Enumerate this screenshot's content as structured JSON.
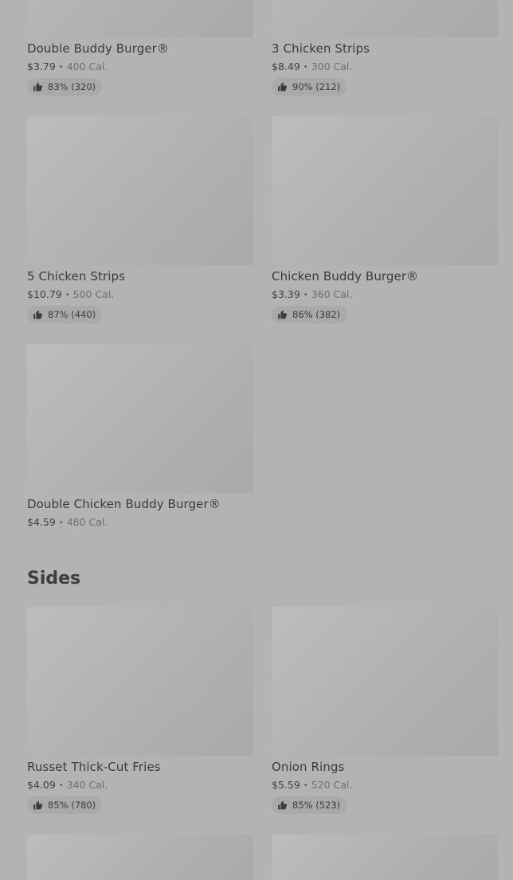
{
  "sections": {
    "sides_title": "Sides"
  },
  "items": [
    {
      "name": "Double Buddy Burger®",
      "price": "$3.79",
      "calories": "400 Cal.",
      "rating": "83% (320)"
    },
    {
      "name": "3 Chicken Strips",
      "price": "$8.49",
      "calories": "300 Cal.",
      "rating": "90% (212)"
    },
    {
      "name": "5 Chicken Strips",
      "price": "$10.79",
      "calories": "500 Cal.",
      "rating": "87% (440)"
    },
    {
      "name": "Chicken Buddy Burger®",
      "price": "$3.39",
      "calories": "360 Cal.",
      "rating": "86% (382)"
    },
    {
      "name": "Double Chicken Buddy Burger®",
      "price": "$4.59",
      "calories": "480 Cal."
    },
    {
      "name": "Russet Thick-Cut Fries",
      "price": "$4.09",
      "calories": "340 Cal.",
      "rating": "85% (780)"
    },
    {
      "name": "Onion Rings",
      "price": "$5.59",
      "calories": "520 Cal.",
      "rating": "85% (523)"
    }
  ],
  "separator": "•",
  "icons": {
    "rating": "thumbs-up-icon"
  },
  "colors": {
    "background": "#b3b3b3",
    "thumbnail": "#b2b2b2",
    "rating_pill": "#a9a9a9",
    "text": "#3b3b3b"
  }
}
